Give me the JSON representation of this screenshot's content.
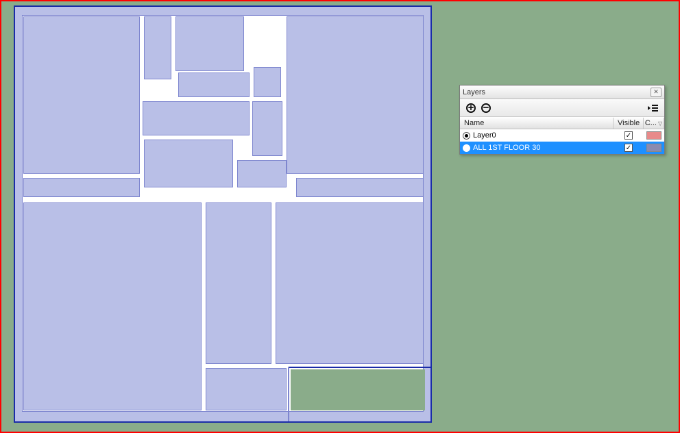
{
  "panel": {
    "title": "Layers",
    "toolbar": {
      "add_layer_tip": "Add Layer",
      "remove_layer_tip": "Remove Layer",
      "flyout_tip": "Details"
    },
    "headers": {
      "name": "Name",
      "visible": "Visible",
      "color_abbrev": "C..."
    },
    "layers": [
      {
        "name": "Layer0",
        "active": true,
        "visible": true,
        "selected": false,
        "color": "#e88a8a"
      },
      {
        "name": "ALL 1ST FLOOR 30",
        "active": false,
        "visible": true,
        "selected": true,
        "color": "#8a8ab0"
      }
    ]
  },
  "colors": {
    "background": "#8aac8a",
    "highlight_border": "#ff0000",
    "edge": "#1a2ca8",
    "face": "#b9bfe7",
    "selection": "#1e90ff"
  }
}
